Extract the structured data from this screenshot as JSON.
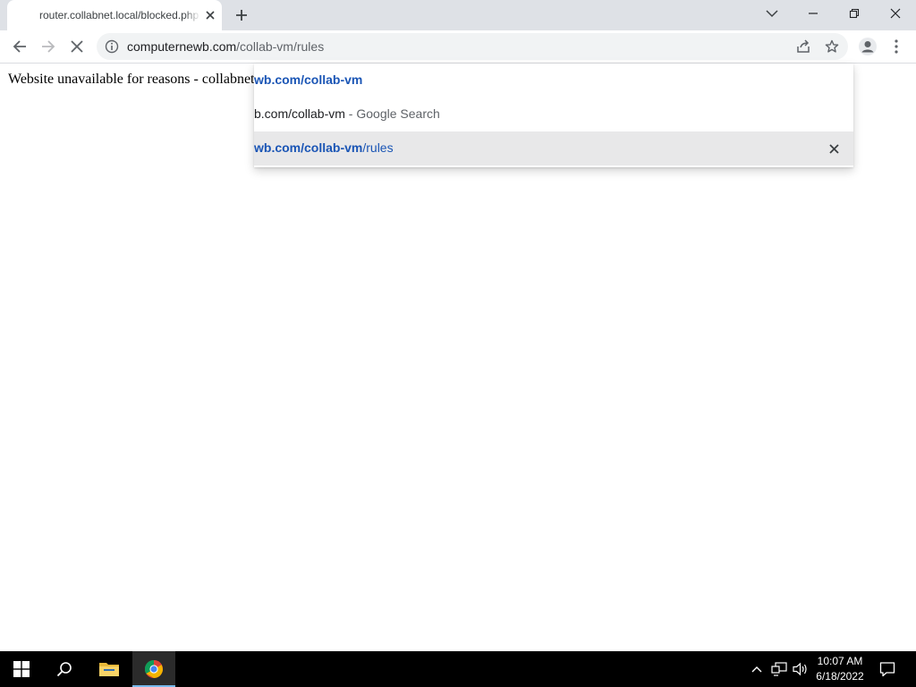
{
  "browser": {
    "tab": {
      "title": "router.collabnet.local/blocked.php"
    },
    "omnibox": {
      "host": "computernewb.com",
      "path": "/collab-vm/rules"
    }
  },
  "page": {
    "message": "Website unavailable for reasons - collabnet"
  },
  "suggestions": [
    {
      "bold": "wb.com/collab-vm",
      "rest": "",
      "type": "url"
    },
    {
      "text": "b.com/collab-vm",
      "separator": " - ",
      "suffix": "Google Search",
      "type": "search"
    },
    {
      "bold": "wb.com/collab-vm",
      "rest": "/rules",
      "type": "url",
      "selected": true
    }
  ],
  "taskbar": {
    "clock_time": "10:07 AM",
    "clock_date": "6/18/2022"
  },
  "colors": {
    "tabstrip_bg": "#dee1e6",
    "omnibox_bg": "#f1f3f4",
    "link_blue": "#1a55b5",
    "taskbar_bg": "#000000",
    "active_indicator": "#76b9ed"
  },
  "icons": {
    "tab_close": "close-icon",
    "new_tab": "plus-icon",
    "tab_search": "chevron-down-icon",
    "minimize": "minimize-icon",
    "restore": "restore-icon",
    "close_window": "close-icon",
    "back": "back-arrow-icon",
    "forward": "forward-arrow-icon",
    "stop": "stop-icon",
    "site_info": "info-icon",
    "share": "share-icon",
    "bookmark": "star-icon",
    "profile": "profile-icon",
    "menu": "kebab-menu-icon",
    "remove_suggestion": "close-icon",
    "start": "windows-start-icon",
    "search": "search-icon",
    "file_explorer": "folder-icon",
    "chrome": "chrome-icon",
    "tray_overflow": "chevron-up-icon",
    "network": "network-icon",
    "volume": "speaker-icon",
    "action_center": "notification-icon"
  }
}
